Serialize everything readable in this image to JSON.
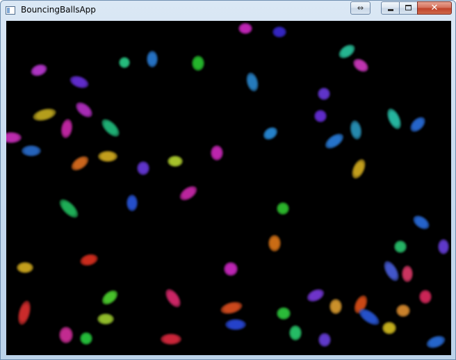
{
  "window": {
    "title": "BouncingBallsApp",
    "buttons": {
      "resize_glyph": "⇔",
      "close_glyph": "✕"
    }
  },
  "canvas": {
    "background": "#000000",
    "balls": [
      {
        "color": "#d228c8"
      },
      {
        "color": "#3a2ad6"
      },
      {
        "color": "#2ac8a0"
      },
      {
        "color": "#d43ac4"
      },
      {
        "color": "#c03ad8"
      },
      {
        "color": "#6a30e0"
      },
      {
        "color": "#28c830"
      },
      {
        "color": "#2a88d0"
      },
      {
        "color": "#c8b020"
      },
      {
        "color": "#b830c8"
      },
      {
        "color": "#d02ab0"
      },
      {
        "color": "#22c080"
      },
      {
        "color": "#2a6ed0"
      },
      {
        "color": "#d22ac0"
      },
      {
        "color": "#e07020"
      },
      {
        "color": "#d8b020"
      },
      {
        "color": "#6a3ae0"
      },
      {
        "color": "#b8d830"
      },
      {
        "color": "#d02ab0"
      },
      {
        "color": "#2a90e0"
      },
      {
        "color": "#6a30e0"
      },
      {
        "color": "#2a80e0"
      },
      {
        "color": "#2a98c0"
      },
      {
        "color": "#2ac8b0"
      },
      {
        "color": "#2a70e0"
      },
      {
        "color": "#d8b020"
      },
      {
        "color": "#30c830"
      },
      {
        "color": "#2a58e0"
      },
      {
        "color": "#d030c0"
      },
      {
        "color": "#22c060"
      },
      {
        "color": "#e07818"
      },
      {
        "color": "#2a6ee0"
      },
      {
        "color": "#2ac870"
      },
      {
        "color": "#6a40e0"
      },
      {
        "color": "#d8b020"
      },
      {
        "color": "#e03020"
      },
      {
        "color": "#d22ac8"
      },
      {
        "color": "#4a60e0"
      },
      {
        "color": "#e03a6a"
      },
      {
        "color": "#e03030"
      },
      {
        "color": "#50d830"
      },
      {
        "color": "#e02a70"
      },
      {
        "color": "#e05020"
      },
      {
        "color": "#7a3ae0"
      },
      {
        "color": "#e0a030"
      },
      {
        "color": "#e05018"
      },
      {
        "color": "#e09030"
      },
      {
        "color": "#e02a60"
      },
      {
        "color": "#a0d030"
      },
      {
        "color": "#2a5ae0"
      },
      {
        "color": "#30d040"
      },
      {
        "color": "#d830a0"
      },
      {
        "color": "#28d040"
      },
      {
        "color": "#e02a40"
      },
      {
        "color": "#2ad070"
      },
      {
        "color": "#6a40e0"
      },
      {
        "color": "#d8c020"
      },
      {
        "color": "#2a70e0"
      },
      {
        "color": "#2a4ae0"
      },
      {
        "color": "#2a7ed8"
      },
      {
        "color": "#6a3ae0"
      },
      {
        "color": "#2ad08a"
      }
    ]
  }
}
